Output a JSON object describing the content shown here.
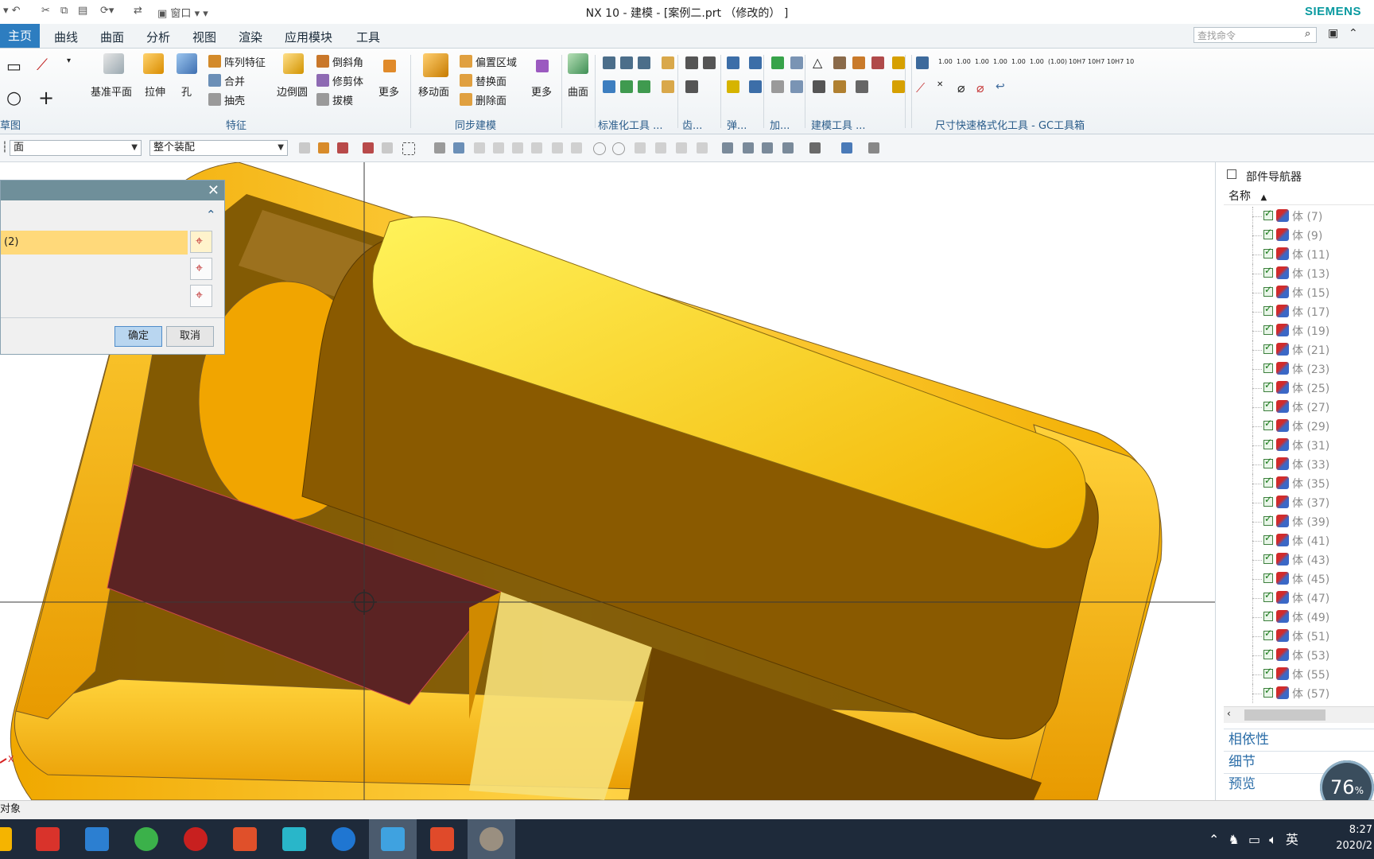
{
  "window": {
    "title": "NX 10 - 建模 - [案例二.prt （修改的）  ]",
    "brand": "SIEMENS",
    "quick_access_window": "窗口"
  },
  "tabs": [
    {
      "label": "主页",
      "active": true
    },
    {
      "label": "曲线"
    },
    {
      "label": "曲面"
    },
    {
      "label": "分析"
    },
    {
      "label": "视图"
    },
    {
      "label": "渲染"
    },
    {
      "label": "应用模块"
    },
    {
      "label": "工具"
    }
  ],
  "command_search": {
    "placeholder": "查找命令"
  },
  "ribbon": {
    "sketch_group": "草图",
    "feature": {
      "datum_plane": "基准平面",
      "extrude": "拉伸",
      "hole": "孔",
      "pattern": "阵列特征",
      "unite": "合并",
      "shell": "抽壳",
      "edge_blend": "边倒圆",
      "chamfer": "倒斜角",
      "trim_body": "修剪体",
      "draft": "拔模",
      "more": "更多",
      "group": "特征"
    },
    "sync": {
      "move_face": "移动面",
      "offset_region": "偏置区域",
      "replace_face": "替换面",
      "delete_face": "删除面",
      "more": "更多",
      "group": "同步建模"
    },
    "surface": {
      "label": "曲面"
    },
    "groups": {
      "standard_tools": "标准化工具 ...",
      "gear": "齿...",
      "spring": "弹...",
      "add": "加...",
      "modeling_tools": "建模工具 ...",
      "dim_tools": "尺寸快速格式化工具 - GC工具箱"
    },
    "dim_labels": [
      "1.00",
      "1.00",
      "1.00",
      "1.00",
      "1.00",
      "1.00",
      "(1.00)",
      "10H7",
      "10H7",
      "10H7",
      "10"
    ]
  },
  "selection_bar": {
    "filter": "面",
    "scope": "整个装配"
  },
  "dialog": {
    "row_label": "(2)",
    "ok": "确定",
    "cancel": "取消"
  },
  "navigator": {
    "title": "部件导航器",
    "column": "名称",
    "items": [
      "体 (7)",
      "体 (9)",
      "体 (11)",
      "体 (13)",
      "体 (15)",
      "体 (17)",
      "体 (19)",
      "体 (21)",
      "体 (23)",
      "体 (25)",
      "体 (27)",
      "体 (29)",
      "体 (31)",
      "体 (33)",
      "体 (35)",
      "体 (37)",
      "体 (39)",
      "体 (41)",
      "体 (43)",
      "体 (45)",
      "体 (47)",
      "体 (49)",
      "体 (51)",
      "体 (53)",
      "体 (55)",
      "体 (57)"
    ],
    "panes": [
      "相依性",
      "细节",
      "预览"
    ]
  },
  "status": {
    "text": "对象"
  },
  "axis": {
    "x": "X"
  },
  "perf": {
    "value": "76",
    "unit": "%"
  },
  "taskbar": {
    "ime": "英",
    "time": "8:27",
    "date": "2020/2"
  },
  "colors": {
    "accent": "#2d7dc0",
    "model_yellow": "#f5b800",
    "model_dark": "#7a4b00",
    "selected_face": "#5b2323"
  }
}
